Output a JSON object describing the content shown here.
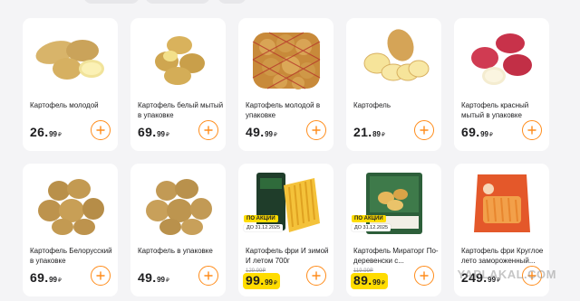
{
  "colors": {
    "accent": "#ff8c1a",
    "promo_yellow": "#ffdc00",
    "background": "#f4f4f6"
  },
  "icons": {
    "add": "plus-icon"
  },
  "watermark": "YAPLAKAL.COM",
  "products": [
    {
      "name": "Картофель молодой",
      "price_int": "26",
      "price_dec": "99",
      "currency": "₽"
    },
    {
      "name": "Картофель белый мытый в упаковке",
      "price_int": "69",
      "price_dec": "99",
      "currency": "₽"
    },
    {
      "name": "Картофель молодой в упаковке",
      "price_int": "49",
      "price_dec": "99",
      "currency": "₽"
    },
    {
      "name": "Картофель",
      "price_int": "21",
      "price_dec": "89",
      "currency": "₽"
    },
    {
      "name": "Картофель красный мытый в упаковке",
      "price_int": "69",
      "price_dec": "99",
      "currency": "₽"
    },
    {
      "name": "Картофель Белорусский в упаковке",
      "price_int": "69",
      "price_dec": "99",
      "currency": "₽"
    },
    {
      "name": "Картофель в упаковке",
      "price_int": "49",
      "price_dec": "99",
      "currency": "₽"
    },
    {
      "name": "Картофель фри И зимой И летом 700г",
      "price_int": "99",
      "price_dec": "99",
      "currency": "₽",
      "old_price": "129.99₽",
      "promo_label": "ПО АКЦИИ",
      "promo_until": "ДО 31.12.2025"
    },
    {
      "name": "Картофель Мираторг По-деревенски с...",
      "price_int": "89",
      "price_dec": "99",
      "currency": "₽",
      "old_price": "119.99₽",
      "promo_label": "ПО АКЦИИ",
      "promo_until": "ДО 31.12.2025"
    },
    {
      "name": "Картофель фри Круглое лето замороженный...",
      "price_int": "249",
      "price_dec": "99",
      "currency": "₽"
    }
  ]
}
